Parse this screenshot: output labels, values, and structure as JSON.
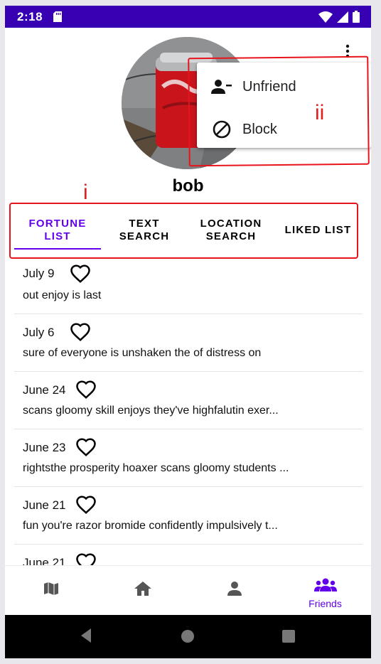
{
  "status_bar": {
    "time": "2:18"
  },
  "profile": {
    "username": "bob"
  },
  "overflow_menu": {
    "items": [
      {
        "label": "Unfriend",
        "icon": "person-remove-icon"
      },
      {
        "label": "Block",
        "icon": "block-icon"
      }
    ]
  },
  "annotations": {
    "menu_marker": "ii",
    "tabs_marker": "i",
    "color": "#e8141b"
  },
  "tabs": [
    {
      "label": "FORTUNE LIST",
      "active": true
    },
    {
      "label": "TEXT SEARCH",
      "active": false
    },
    {
      "label": "LOCATION SEARCH",
      "active": false
    },
    {
      "label": "LIKED LIST",
      "active": false
    }
  ],
  "fortunes": [
    {
      "date": "July 9",
      "text": "out enjoy is last"
    },
    {
      "date": "July 6",
      "text": "sure of everyone is unshaken the of distress on"
    },
    {
      "date": "June 24",
      "text": "scans gloomy skill enjoys they've highfalutin exer..."
    },
    {
      "date": "June 23",
      "text": "rightsthe prosperity hoaxer scans gloomy students ..."
    },
    {
      "date": "June 21",
      "text": "fun you're razor bromide confidently impulsively t..."
    },
    {
      "date": "June 21",
      "text": ""
    }
  ],
  "bottom_nav": {
    "items": [
      {
        "icon": "map-icon",
        "label": ""
      },
      {
        "icon": "home-icon",
        "label": ""
      },
      {
        "icon": "person-icon",
        "label": ""
      },
      {
        "icon": "friends-icon",
        "label": "Friends",
        "active": true
      }
    ]
  },
  "colors": {
    "accent": "#6200ee",
    "status_bar": "#3700b3"
  }
}
